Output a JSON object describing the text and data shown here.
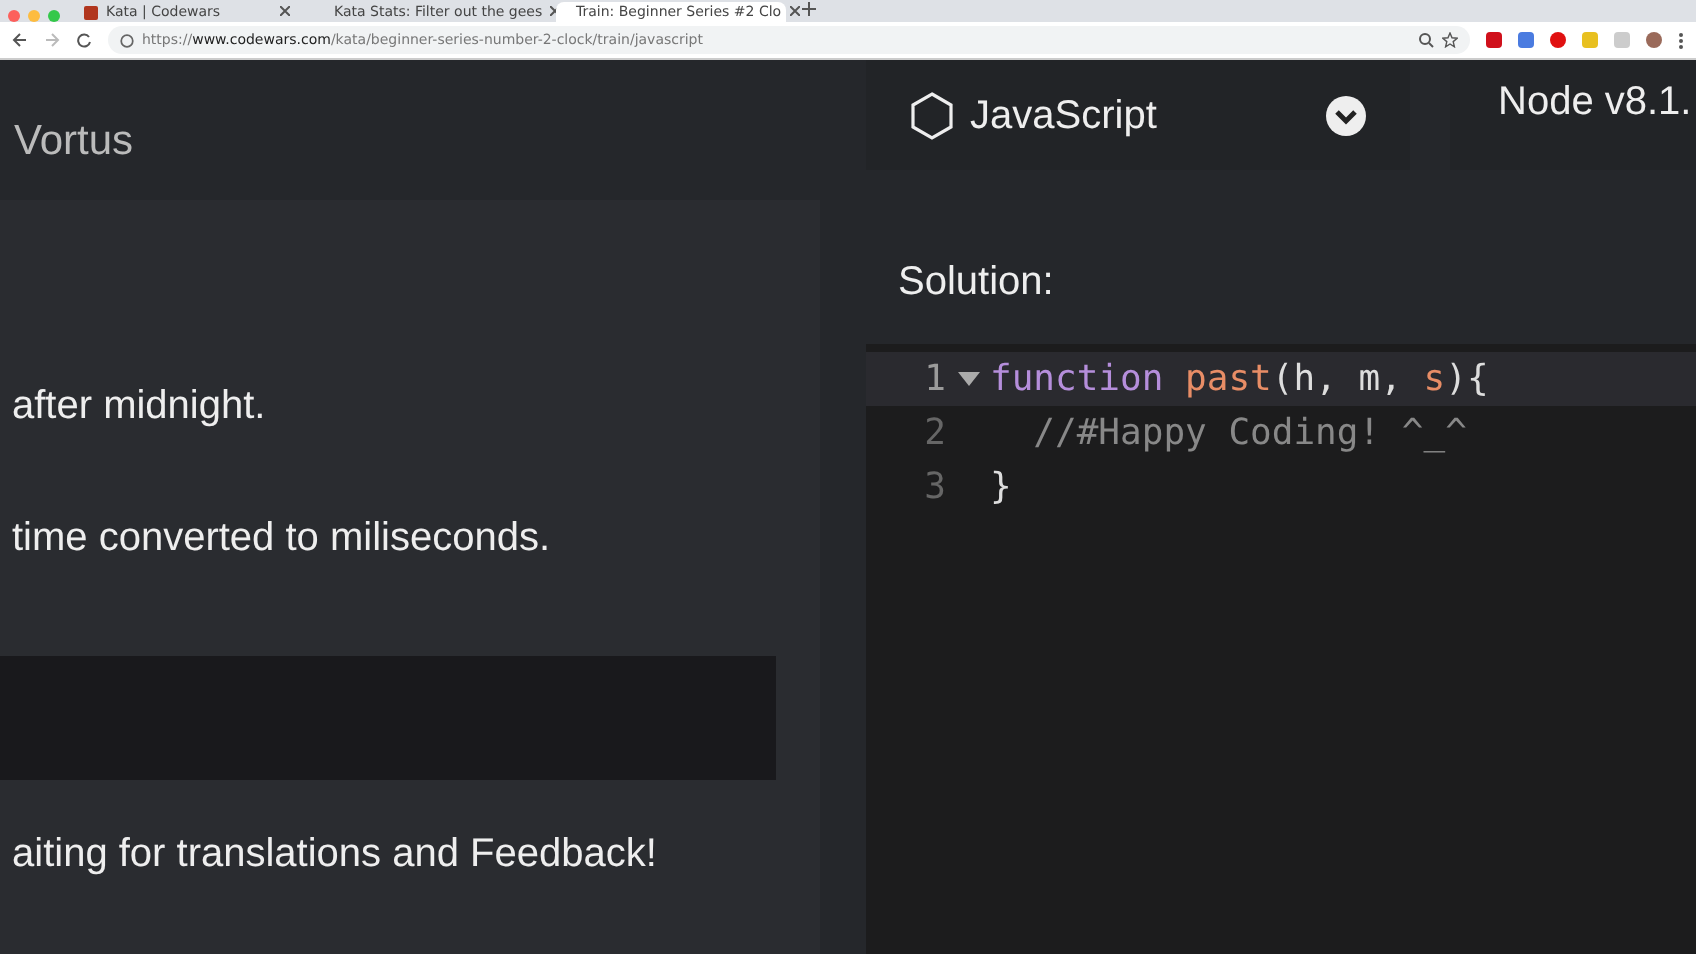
{
  "browser": {
    "tabs": [
      {
        "title": "Kata | Codewars",
        "selected": false
      },
      {
        "title": "Kata Stats: Filter out the gees",
        "selected": false
      },
      {
        "title": "Train: Beginner Series #2 Clo",
        "selected": true
      }
    ],
    "url": {
      "host": "www.codewars.com",
      "path": "/kata/beginner-series-number-2-clock/train/javascript",
      "scheme": "https://"
    }
  },
  "header": {
    "user": "Vortus",
    "language": "JavaScript",
    "runtime": "Node v8.1."
  },
  "description": {
    "lines": [
      "after midnight.",
      "time converted to miliseconds."
    ],
    "footer": "aiting for translations and Feedback!"
  },
  "solution": {
    "title": "Solution:",
    "code_lines": [
      {
        "number": "1",
        "foldable": true,
        "active": true,
        "tokens": [
          {
            "kind": "keyword",
            "text": "function "
          },
          {
            "kind": "name",
            "text": "past"
          },
          {
            "kind": "plain",
            "text": "(h, m, "
          },
          {
            "kind": "name",
            "text": "s"
          },
          {
            "kind": "plain",
            "text": "){"
          }
        ]
      },
      {
        "number": "2",
        "foldable": false,
        "active": false,
        "tokens": [
          {
            "kind": "comment",
            "text": "  //#Happy Coding! ^_^"
          }
        ]
      },
      {
        "number": "3",
        "foldable": false,
        "active": false,
        "tokens": [
          {
            "kind": "plain",
            "text": "}"
          }
        ]
      }
    ]
  }
}
